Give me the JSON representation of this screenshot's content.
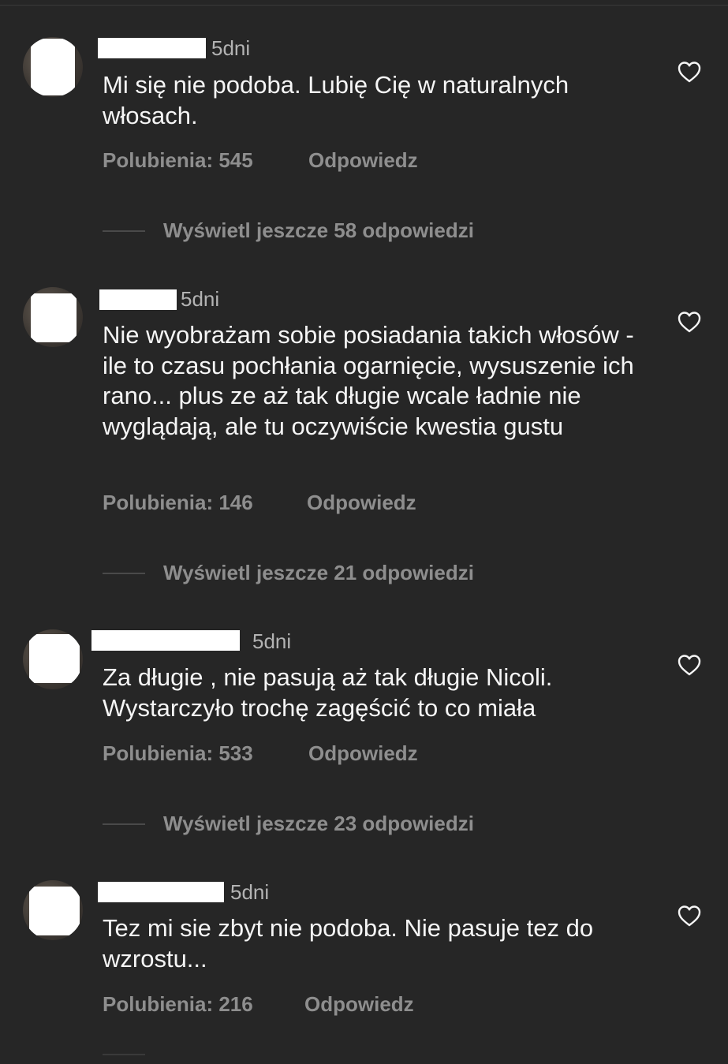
{
  "comments": [
    {
      "time": "5dni",
      "text": "Mi się nie podoba. Lubię Cię w naturalnych włosach.",
      "likes": "Polubienia: 545",
      "reply": "Odpowiedz",
      "more": "Wyświetl jeszcze 58 odpowiedzi"
    },
    {
      "time": "5dni",
      "text": "Nie wyobrażam sobie posiadania takich włosów - ile to czasu pochłania ogarnięcie, wysuszenie ich rano... plus ze aż tak długie wcale ładnie nie wyglądają, ale tu oczywiście kwestia gustu",
      "likes": "Polubienia: 146",
      "reply": "Odpowiedz",
      "more": "Wyświetl jeszcze 21 odpowiedzi"
    },
    {
      "time": "5dni",
      "text": "Za długie , nie pasują aż tak długie Nicoli. Wystarczyło trochę zagęścić to co miała",
      "likes": "Polubienia: 533",
      "reply": "Odpowiedz",
      "more": "Wyświetl jeszcze 23 odpowiedzi"
    },
    {
      "time": "5dni",
      "text": "Tez mi sie zbyt nie podoba. Nie pasuje tez do wzrostu...",
      "likes": "Polubienia: 216",
      "reply": "Odpowiedz"
    }
  ],
  "colors": {
    "background": "#262626",
    "text_primary": "#f5f5f5",
    "text_secondary": "#8e8e8e",
    "redaction": "#ffffff"
  },
  "icons": {
    "like": "heart-outline-icon"
  }
}
